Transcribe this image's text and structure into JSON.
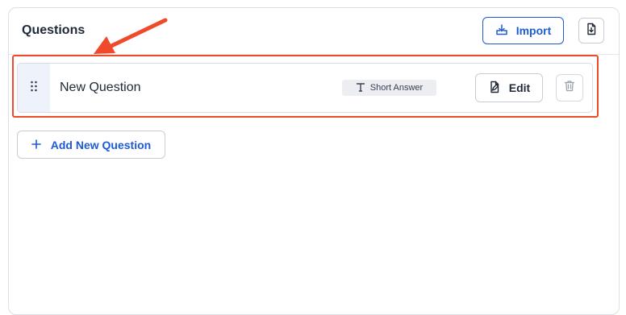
{
  "header": {
    "title": "Questions",
    "import_label": "Import",
    "import_icon": "import-tray-icon",
    "export_icon": "file-download-icon"
  },
  "questions": [
    {
      "title": "New Question",
      "type_label": "Short Answer",
      "type_icon": "text-t-icon",
      "edit_label": "Edit",
      "edit_icon": "edit-file-icon",
      "delete_icon": "trash-icon",
      "drag_icon": "drag-handle-icon"
    }
  ],
  "add_question_label": "Add New Question",
  "colors": {
    "accent": "#1d5bd6",
    "highlight": "#ef4b2b",
    "drag_bg": "#eef2fb"
  }
}
